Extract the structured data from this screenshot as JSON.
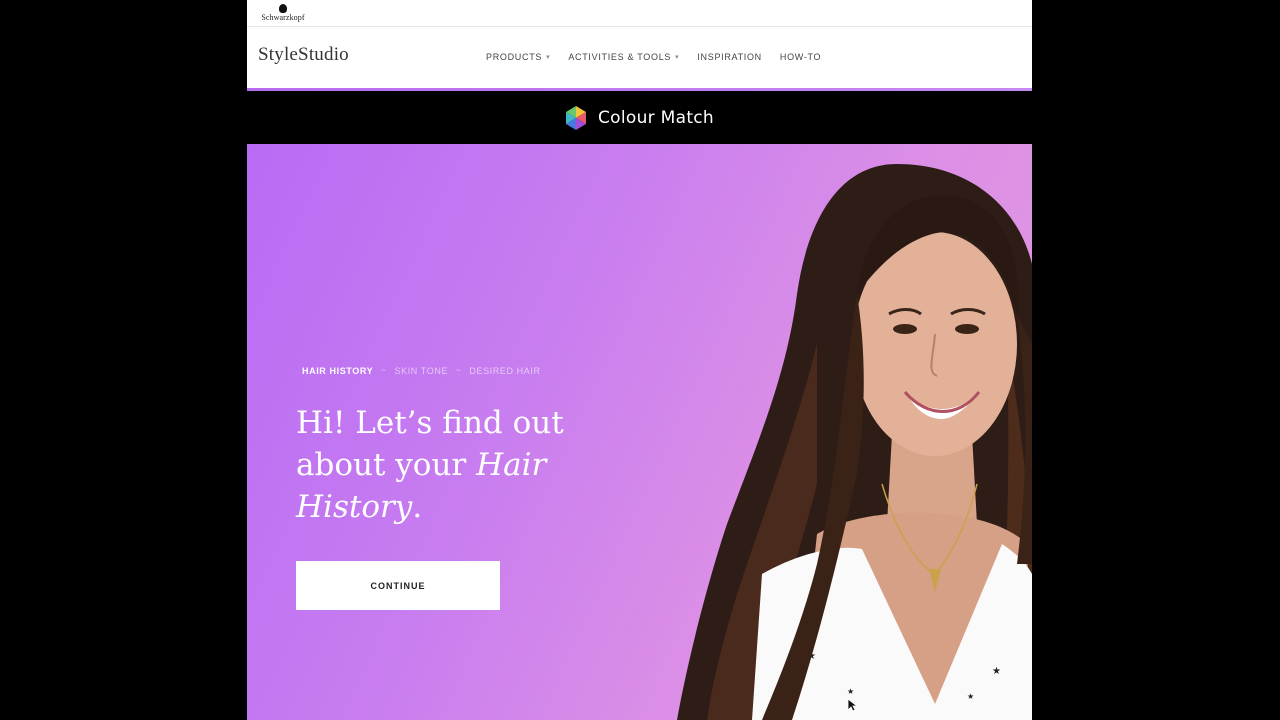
{
  "brand": {
    "name": "Schwarzkopf"
  },
  "nav": {
    "site_title": "StyleStudio",
    "items": [
      {
        "label": "PRODUCTS",
        "has_dropdown": true
      },
      {
        "label": "ACTIVITIES & TOOLS",
        "has_dropdown": true
      },
      {
        "label": "INSPIRATION",
        "has_dropdown": false
      },
      {
        "label": "HOW-TO",
        "has_dropdown": false
      }
    ]
  },
  "colour_match": {
    "title": "Colour Match",
    "icon": "hexagon-logo-icon"
  },
  "hero": {
    "steps": [
      {
        "label": "HAIR HISTORY",
        "active": true
      },
      {
        "label": "SKIN TONE",
        "active": false
      },
      {
        "label": "DESIRED HAIR",
        "active": false
      }
    ],
    "step_separator": "~",
    "headline_line1": "Hi! Let’s find out",
    "headline_line2_prefix": "about your ",
    "headline_emphasis": "Hair History",
    "headline_end": ".",
    "continue_label": "CONTINUE"
  },
  "colors": {
    "accent": "#b76cf0",
    "hero_gradient_start": "#b86cf4",
    "hero_gradient_end": "#e69ade",
    "bar_background": "#000000"
  }
}
